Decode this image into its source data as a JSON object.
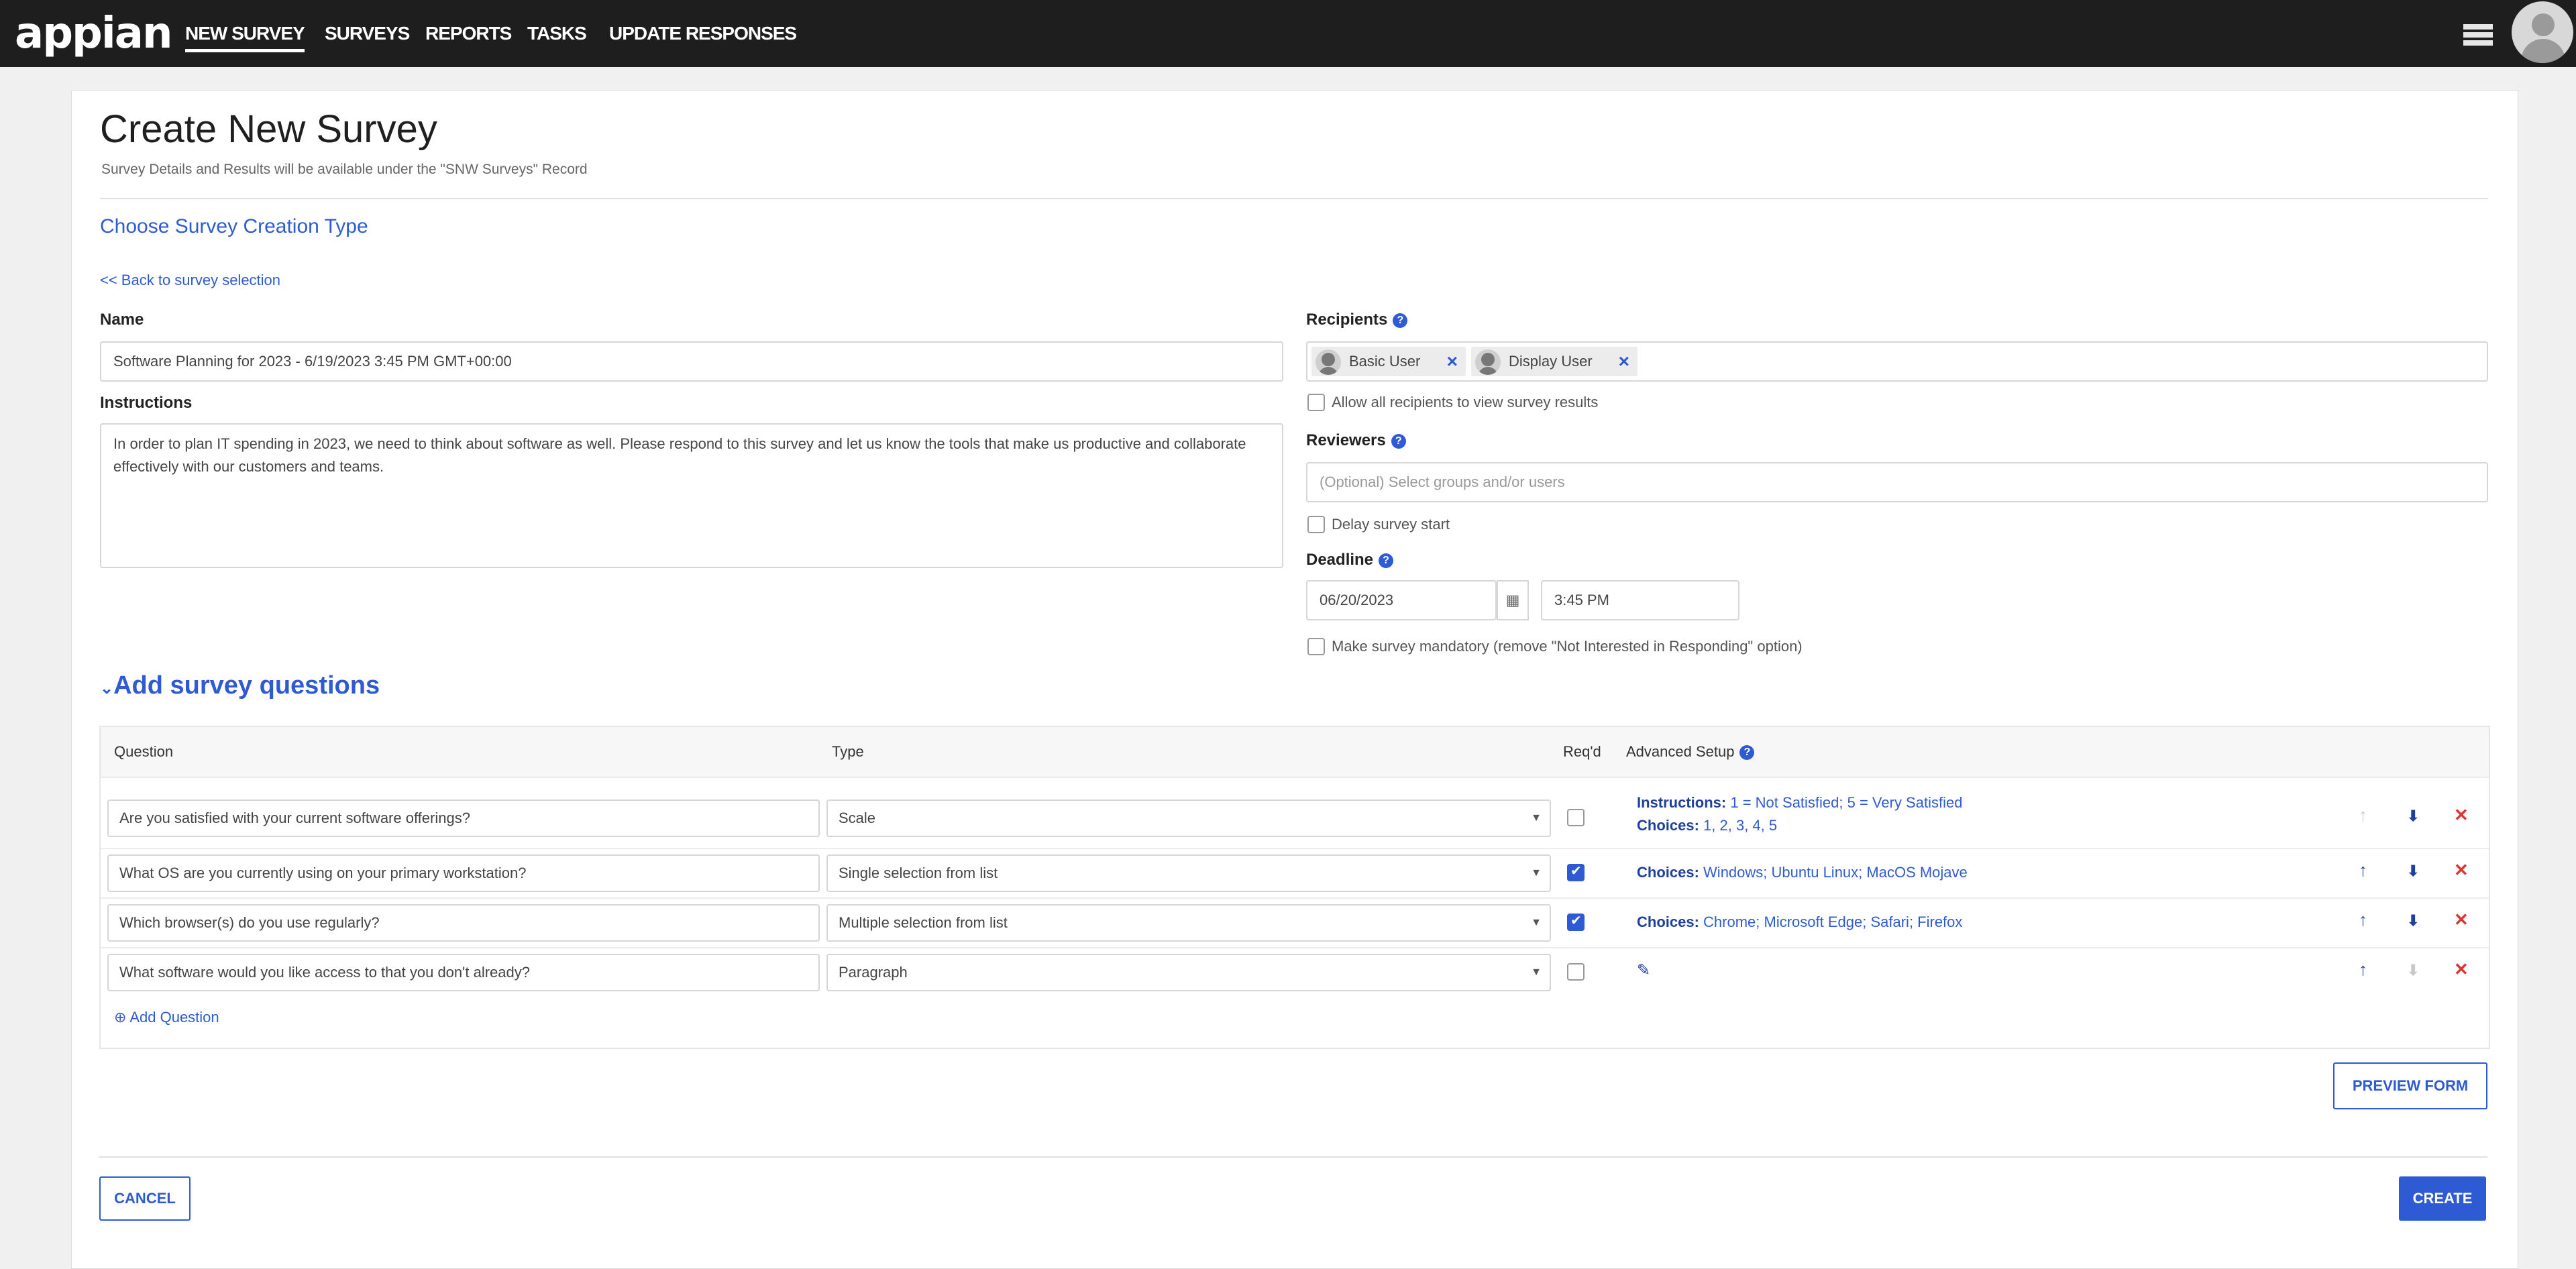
{
  "app": {
    "logo": "appian",
    "nav": [
      {
        "label": "NEW SURVEY",
        "active": true
      },
      {
        "label": "SURVEYS",
        "active": false
      },
      {
        "label": "REPORTS",
        "active": false
      },
      {
        "label": "TASKS",
        "active": false
      },
      {
        "label": "UPDATE RESPONSES",
        "active": false
      }
    ],
    "menu_icon": "hamburger-icon",
    "avatar_icon": "user-avatar-icon"
  },
  "page": {
    "title": "Create New Survey",
    "subtitle": "Survey Details and Results will be available under the \"SNW Surveys\" Record",
    "creation_type_link": "Choose Survey Creation Type",
    "back_link": "<< Back to survey selection"
  },
  "form": {
    "name_label": "Name",
    "name_value": "Software Planning for 2023 - 6/19/2023 3:45 PM GMT+00:00",
    "instructions_label": "Instructions",
    "instructions_value": "In order to plan IT spending in 2023, we need to think about software as well. Please respond to this survey and let us know the tools that make us productive and collaborate effectively with our customers and teams.",
    "recipients_label": "Recipients",
    "recipients": [
      "Basic User",
      "Display User"
    ],
    "allow_results_label": "Allow all recipients to view survey results",
    "allow_results_checked": false,
    "reviewers_label": "Reviewers",
    "reviewers_placeholder": "(Optional) Select groups and/or users",
    "delay_start_label": "Delay survey start",
    "delay_start_checked": false,
    "deadline_label": "Deadline",
    "deadline_date": "06/20/2023",
    "deadline_time": "3:45 PM",
    "mandatory_label": "Make survey mandatory (remove \"Not Interested in Responding\" option)",
    "mandatory_checked": false
  },
  "questions": {
    "section_title": "Add survey questions",
    "columns": [
      "Question",
      "Type",
      "Req'd",
      "Advanced Setup"
    ],
    "rows": [
      {
        "question": "Are you satisfied with your current software offerings?",
        "type": "Scale",
        "required": false,
        "advanced_line1_label": "Instructions:",
        "advanced_line1_value": "1 = Not Satisfied; 5 = Very Satisfied",
        "advanced_line2_label": "Choices:",
        "advanced_line2_value": "1, 2, 3, 4, 5"
      },
      {
        "question": "What OS are you currently using on your primary workstation?",
        "type": "Single selection from list",
        "required": true,
        "advanced_line1_label": "Choices:",
        "advanced_line1_value": "Windows; Ubuntu Linux; MacOS Mojave"
      },
      {
        "question": "Which browser(s) do you use regularly?",
        "type": "Multiple selection from list",
        "required": true,
        "advanced_line1_label": "Choices:",
        "advanced_line1_value": "Chrome; Microsoft Edge; Safari; Firefox"
      },
      {
        "question": "What software would you like access to that you don't already?",
        "type": "Paragraph",
        "required": false,
        "advanced_icon": "pencil-icon"
      }
    ],
    "add_question_label": "Add Question"
  },
  "buttons": {
    "preview": "PREVIEW FORM",
    "cancel": "CANCEL",
    "create": "CREATE"
  },
  "colors": {
    "topbar": "#1e1e1e",
    "accent": "#2e5bd3",
    "delete": "#dd3333"
  }
}
